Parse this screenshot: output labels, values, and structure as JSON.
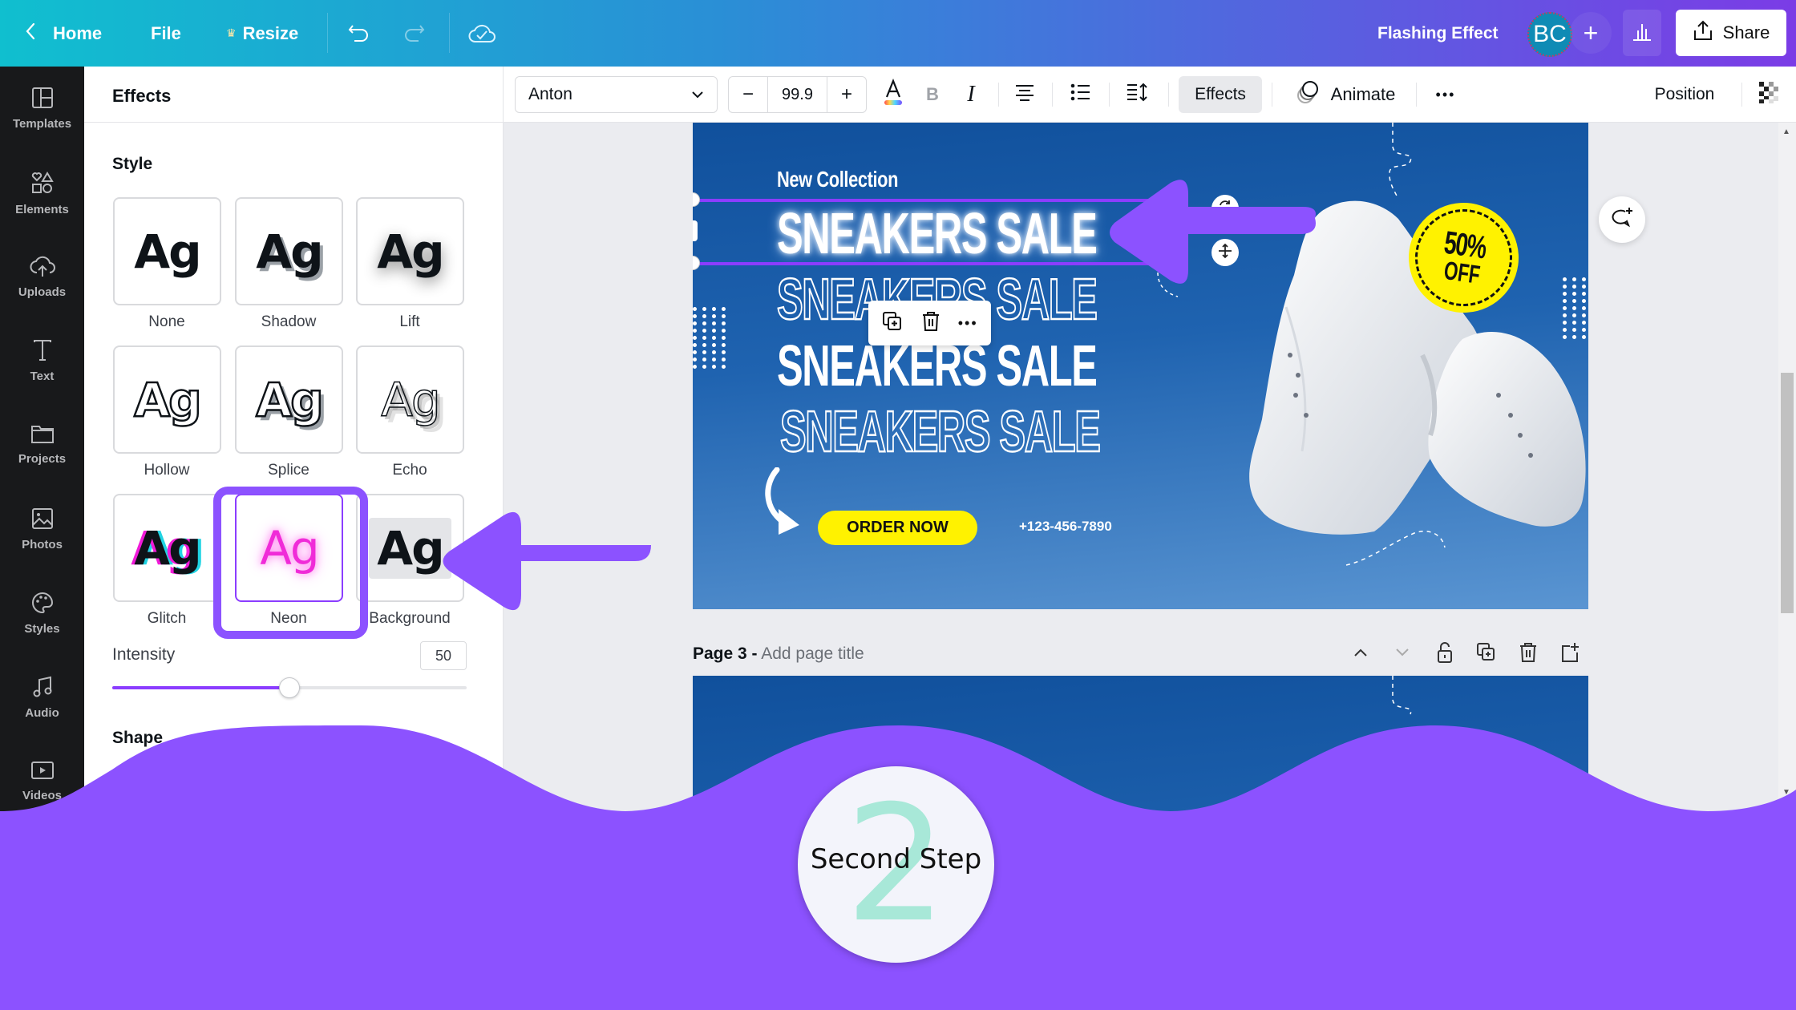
{
  "topbar": {
    "home_label": "Home",
    "file_label": "File",
    "resize_label": "Resize",
    "design_title": "Flashing Effect",
    "avatar_initials": "BC",
    "share_label": "Share",
    "gradient_colors": [
      "#10bfcf",
      "#7b3ce6"
    ]
  },
  "rail": {
    "items": [
      {
        "label": "Templates",
        "icon": "templates-icon"
      },
      {
        "label": "Elements",
        "icon": "elements-icon"
      },
      {
        "label": "Uploads",
        "icon": "uploads-icon"
      },
      {
        "label": "Text",
        "icon": "text-icon"
      },
      {
        "label": "Projects",
        "icon": "projects-icon"
      },
      {
        "label": "Photos",
        "icon": "photos-icon"
      },
      {
        "label": "Styles",
        "icon": "styles-icon"
      },
      {
        "label": "Audio",
        "icon": "audio-icon"
      },
      {
        "label": "Videos",
        "icon": "videos-icon"
      }
    ]
  },
  "panel": {
    "title": "Effects",
    "style_heading": "Style",
    "styles": [
      {
        "label": "None",
        "sample": "Ag"
      },
      {
        "label": "Shadow",
        "sample": "Ag"
      },
      {
        "label": "Lift",
        "sample": "Ag"
      },
      {
        "label": "Hollow",
        "sample": "Ag"
      },
      {
        "label": "Splice",
        "sample": "Ag"
      },
      {
        "label": "Echo",
        "sample": "Ag"
      },
      {
        "label": "Glitch",
        "sample": "Ag"
      },
      {
        "label": "Neon",
        "sample": "Ag"
      },
      {
        "label": "Background",
        "sample": "Ag"
      }
    ],
    "selected_style": "Neon",
    "intensity_label": "Intensity",
    "intensity_value": "50",
    "intensity_percent": 50,
    "shape_heading": "Shape"
  },
  "toolbar": {
    "font_name": "Anton",
    "font_size": "99.9",
    "minus_label": "−",
    "plus_label": "+",
    "bold_label": "B",
    "italic_label": "I",
    "effects_label": "Effects",
    "animate_label": "Animate",
    "more_label": "•••",
    "position_label": "Position"
  },
  "canvas": {
    "new_collection": "New Collection",
    "headline_lines": [
      "SNEAKERS SALE",
      "SNEAKERS SALE",
      "SNEAKERS SALE",
      "SNEAKERS SALE"
    ],
    "badge_line1": "50%",
    "badge_line2": "OFF",
    "order_button": "ORDER NOW",
    "phone": "+123-456-7890",
    "context_more": "•••",
    "accent_yellow": "#fff200",
    "page_blue": "#10509c"
  },
  "page3": {
    "label": "Page 3 -",
    "title_placeholder": "Add page title"
  },
  "overlay": {
    "step_number": "2",
    "step_text": "Second Step",
    "overlay_color": "#8c52ff",
    "step_number_color": "#a8e8d8"
  }
}
